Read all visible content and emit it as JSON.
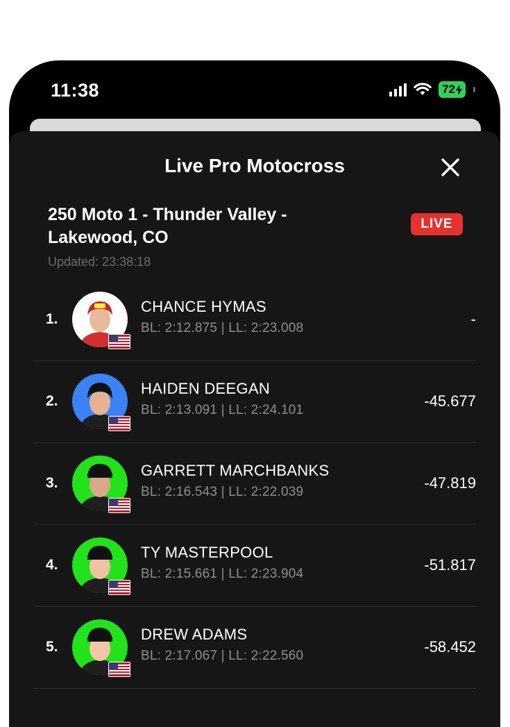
{
  "status": {
    "time": "11:38",
    "battery": "72"
  },
  "sheet": {
    "title": "Live Pro Motocross",
    "race_title": "250 Moto 1 - Thunder Valley - Lakewood, CO",
    "live_label": "LIVE",
    "updated": "Updated: 23:38:18"
  },
  "colors": {
    "live": "#e5322d",
    "background": "#161616",
    "accent_green": "#30d158"
  },
  "riders": [
    {
      "position": "1.",
      "name": "CHANCE HYMAS",
      "laps": "BL: 2:12.875 | LL: 2:23.008",
      "gap": "-",
      "avatar_bg": "#ffffff"
    },
    {
      "position": "2.",
      "name": "HAIDEN DEEGAN",
      "laps": "BL: 2:13.091 | LL: 2:24.101",
      "gap": "-45.677",
      "avatar_bg": "#3b82f6"
    },
    {
      "position": "3.",
      "name": "GARRETT MARCHBANKS",
      "laps": "BL: 2:16.543 | LL: 2:22.039",
      "gap": "-47.819",
      "avatar_bg": "#22e31b"
    },
    {
      "position": "4.",
      "name": "TY MASTERPOOL",
      "laps": "BL: 2:15.661 | LL: 2:23.904",
      "gap": "-51.817",
      "avatar_bg": "#22e31b"
    },
    {
      "position": "5.",
      "name": "DREW ADAMS",
      "laps": "BL: 2:17.067 | LL: 2:22.560",
      "gap": "-58.452",
      "avatar_bg": "#22e31b"
    }
  ]
}
